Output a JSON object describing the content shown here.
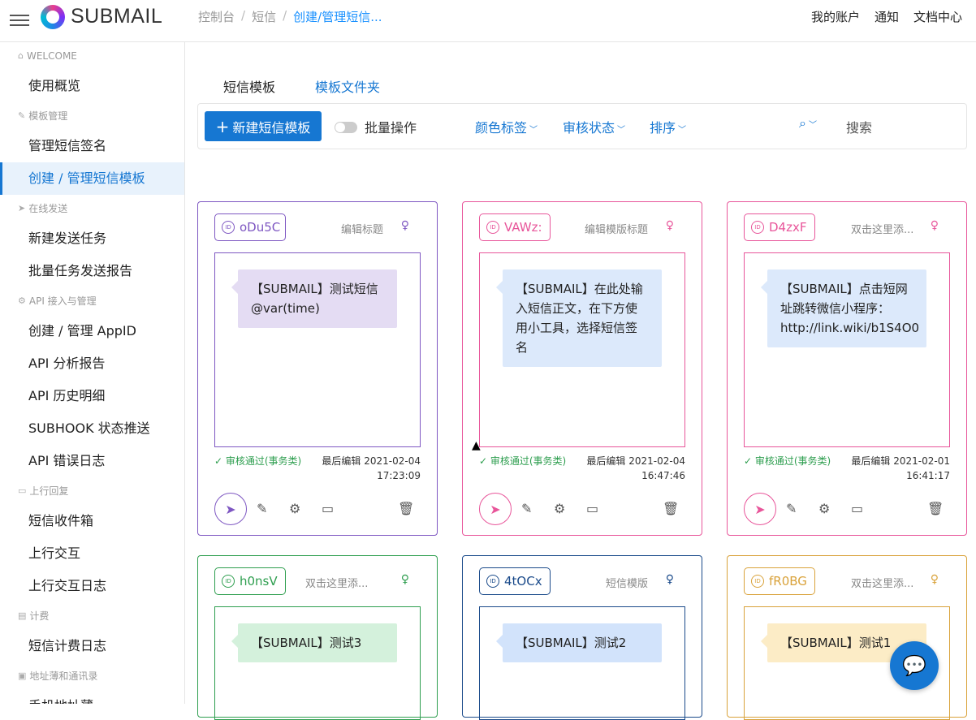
{
  "header": {
    "logo_text": "SUBMAIL",
    "breadcrumbs": [
      "控制台",
      "短信",
      "创建/管理短信..."
    ],
    "links": [
      "我的账户",
      "通知",
      "文档中心"
    ]
  },
  "sidebar": {
    "sections": [
      {
        "label": "WELCOME",
        "icon": "home-icon",
        "items": [
          "使用概览"
        ]
      },
      {
        "label": "模板管理",
        "icon": "pencil-icon",
        "items": [
          "管理短信签名",
          "创建 / 管理短信模板"
        ]
      },
      {
        "label": "在线发送",
        "icon": "send-icon",
        "items": [
          "新建发送任务",
          "批量任务发送报告"
        ]
      },
      {
        "label": "API 接入与管理",
        "icon": "api-icon",
        "items": [
          "创建 / 管理 AppID",
          "API 分析报告",
          "API 历史明细",
          "SUBHOOK 状态推送",
          "API 错误日志"
        ]
      },
      {
        "label": "上行回复",
        "icon": "inbox-icon",
        "items": [
          "短信收件箱",
          "上行交互",
          "上行交互日志"
        ]
      },
      {
        "label": "计费",
        "icon": "bill-icon",
        "items": [
          "短信计费日志"
        ]
      },
      {
        "label": "地址薄和通讯录",
        "icon": "contacts-icon",
        "items": [
          "手机地址薄"
        ]
      }
    ],
    "active_item": "创建 / 管理短信模板"
  },
  "tabs": [
    "短信模板",
    "模板文件夹"
  ],
  "toolbar": {
    "new_button": "新建短信模板",
    "batch_label": "批量操作",
    "filters": [
      "颜色标签",
      "审核状态",
      "排序"
    ],
    "search_label": "搜索"
  },
  "cards": [
    {
      "id": "oDu5C",
      "title": "编辑标题",
      "text": "【SUBMAIL】测试短信@var(time)",
      "status": "审核通过(事务类)",
      "edited_label": "最后编辑",
      "date": "2021-02-04",
      "time": "17:23:09",
      "color": "#7e57c2",
      "bubble": "#e4dcf3"
    },
    {
      "id": "VAWz:",
      "title": "编辑模版标题",
      "text": "【SUBMAIL】在此处输入短信正文，在下方使用小工具，选择短信签名",
      "status": "审核通过(事务类)",
      "edited_label": "最后编辑",
      "date": "2021-02-04",
      "time": "16:47:46",
      "color": "#e8559a",
      "bubble": "#dce9fb"
    },
    {
      "id": "D4zxF",
      "title": "双击这里添...",
      "text": "【SUBMAIL】点击短网址跳转微信小程序：http://link.wiki/b1S4O0",
      "status": "审核通过(事务类)",
      "edited_label": "最后编辑",
      "date": "2021-02-01",
      "time": "16:41:17",
      "color": "#e8559a",
      "bubble": "#dce9fb"
    },
    {
      "id": "h0nsV",
      "title": "双击这里添...",
      "text": "【SUBMAIL】测试3",
      "status": "",
      "edited_label": "",
      "date": "",
      "time": "",
      "color": "#2e9e4f",
      "bubble": "#d4f1dc"
    },
    {
      "id": "4tOCx",
      "title": "短信模版",
      "text": "【SUBMAIL】测试2",
      "status": "",
      "edited_label": "",
      "date": "",
      "time": "",
      "color": "#1a4a8a",
      "bubble": "#d2e3fb"
    },
    {
      "id": "fR0BG",
      "title": "双击这里添...",
      "text": "【SUBMAIL】测试1",
      "status": "",
      "edited_label": "",
      "date": "",
      "time": "",
      "color": "#d9a23a",
      "bubble": "#fcecc6"
    }
  ]
}
